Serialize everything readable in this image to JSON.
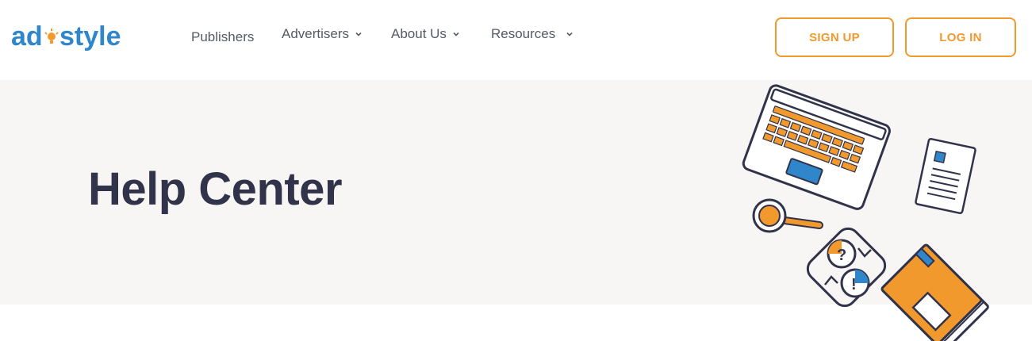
{
  "brand": {
    "name": "adstyle",
    "logo_left": "ad",
    "logo_right": "style"
  },
  "nav": {
    "items": [
      {
        "label": "Publishers",
        "has_dropdown": false
      },
      {
        "label": "Advertisers",
        "has_dropdown": true
      },
      {
        "label": "About Us",
        "has_dropdown": true
      },
      {
        "label": "Resources",
        "has_dropdown": true
      }
    ]
  },
  "actions": {
    "signup_label": "SIGN UP",
    "login_label": "LOG IN"
  },
  "hero": {
    "title": "Help Center"
  },
  "colors": {
    "accent": "#f2992e",
    "brand_blue": "#2f86cb",
    "dark_text": "#31334a",
    "hero_bg": "#f7f6f4"
  }
}
